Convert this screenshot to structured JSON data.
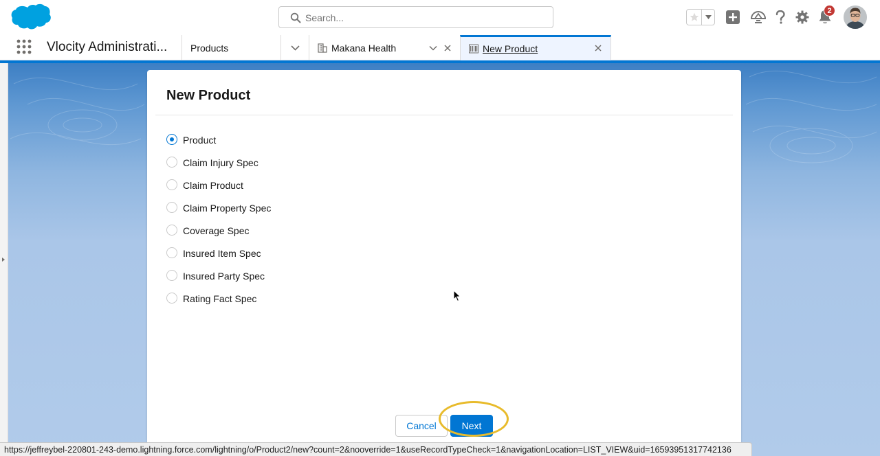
{
  "header": {
    "logo": "salesforce-cloud-logo",
    "search_placeholder": "Search...",
    "notification_count": "2",
    "colors": {
      "brand": "#0176d3",
      "logo": "#00a1e0",
      "badge": "#c23934"
    }
  },
  "navbar": {
    "app_name": "Vlocity Administrati...",
    "tabs": [
      {
        "label": "Products",
        "icon": ""
      },
      {
        "label": "Makana Health",
        "icon": "building-icon"
      },
      {
        "label": "New Product",
        "icon": "barcode-icon",
        "active": true
      }
    ]
  },
  "modal": {
    "title": "New Product",
    "record_types": [
      {
        "label": "Product",
        "selected": true
      },
      {
        "label": "Claim Injury Spec",
        "selected": false
      },
      {
        "label": "Claim Product",
        "selected": false
      },
      {
        "label": "Claim Property Spec",
        "selected": false
      },
      {
        "label": "Coverage Spec",
        "selected": false
      },
      {
        "label": "Insured Item Spec",
        "selected": false
      },
      {
        "label": "Insured Party Spec",
        "selected": false
      },
      {
        "label": "Rating Fact Spec",
        "selected": false
      }
    ],
    "cancel_label": "Cancel",
    "next_label": "Next"
  },
  "status_bar": {
    "url": "https://jeffreybel-220801-243-demo.lightning.force.com/lightning/o/Product2/new?count=2&nooverride=1&useRecordTypeCheck=1&navigationLocation=LIST_VIEW&uid=16593951317742136"
  }
}
